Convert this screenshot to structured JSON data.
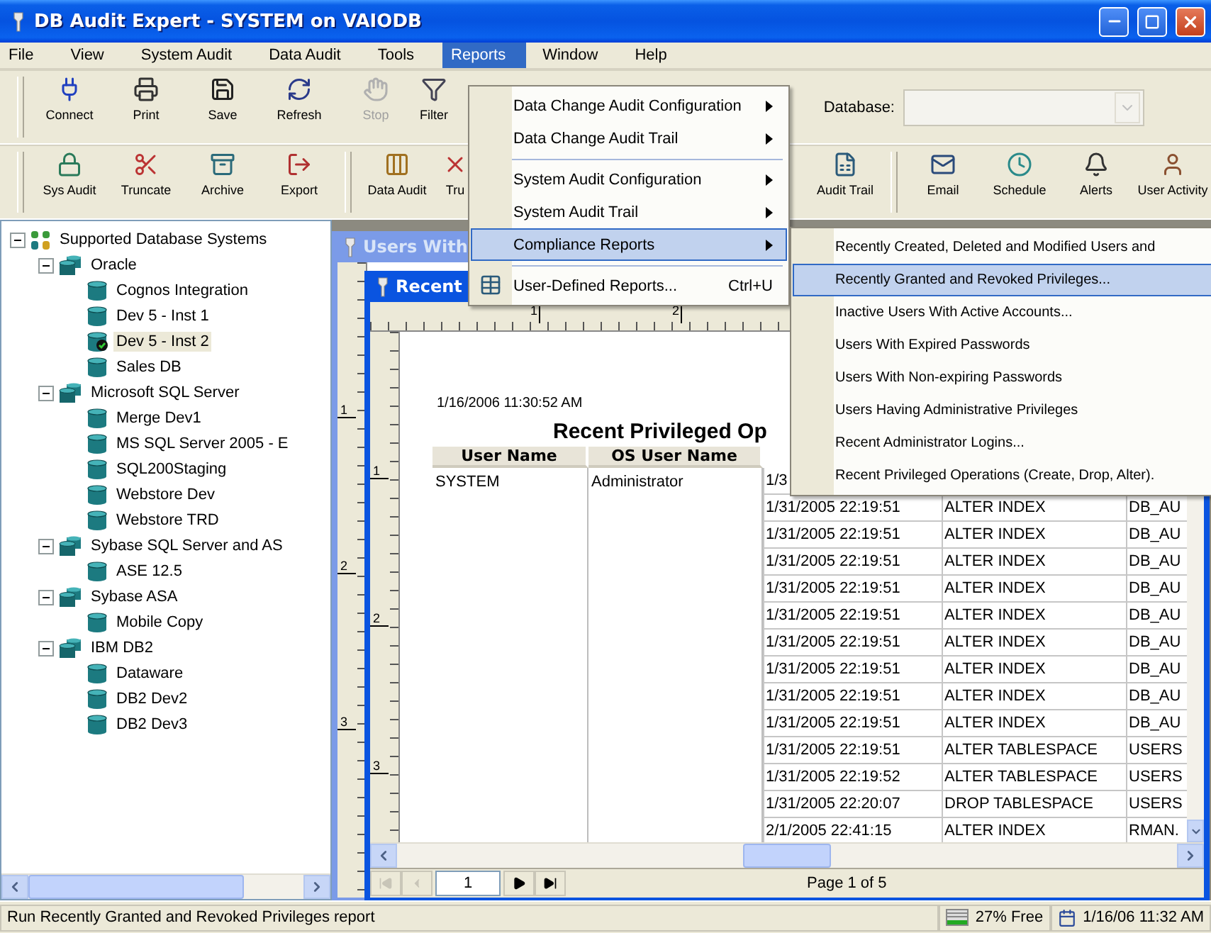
{
  "window": {
    "title": "DB Audit Expert - SYSTEM on VAIODB"
  },
  "menu_bar": [
    {
      "label": "File",
      "selected": false
    },
    {
      "label": "View",
      "selected": false
    },
    {
      "label": "System Audit",
      "selected": false
    },
    {
      "label": "Data Audit",
      "selected": false
    },
    {
      "label": "Tools",
      "selected": false
    },
    {
      "label": "Reports",
      "selected": true
    },
    {
      "label": "Window",
      "selected": false
    },
    {
      "label": "Help",
      "selected": false
    }
  ],
  "toolbar_1": {
    "buttons": [
      {
        "label": "Connect",
        "disabled": false
      },
      {
        "label": "Print",
        "disabled": false
      },
      {
        "label": "Save",
        "disabled": false
      },
      {
        "label": "Refresh",
        "disabled": false
      },
      {
        "label": "Stop",
        "disabled": true
      },
      {
        "label": "Filter",
        "disabled": false
      }
    ],
    "database": {
      "label": "Database:",
      "disabled": true
    }
  },
  "toolbar_2": {
    "groups": [
      [
        {
          "label": "Sys Audit"
        },
        {
          "label": "Truncate"
        },
        {
          "label": "Archive"
        },
        {
          "label": "Export"
        }
      ],
      [
        {
          "label": "Data Audit"
        },
        {
          "label": "Tru"
        }
      ],
      [
        {
          "label": "Audit Trail"
        }
      ],
      [
        {
          "label": "Email"
        },
        {
          "label": "Schedule"
        },
        {
          "label": "Alerts"
        },
        {
          "label": "User Activity"
        }
      ]
    ]
  },
  "tree": {
    "nodes": [
      {
        "label": "Supported Database Systems",
        "expanded": true,
        "selected": false,
        "children": [
          {
            "label": "Oracle",
            "expanded": true,
            "selected": false,
            "children": [
              {
                "label": "Cognos Integration",
                "selected": false
              },
              {
                "label": "Dev 5 - Inst 1",
                "selected": false
              },
              {
                "label": "Dev 5 - Inst 2",
                "selected": true
              },
              {
                "label": "Sales DB",
                "selected": false
              }
            ]
          },
          {
            "label": "Microsoft SQL Server",
            "expanded": true,
            "selected": false,
            "children": [
              {
                "label": "Merge Dev1",
                "selected": false
              },
              {
                "label": "MS SQL Server 2005 - E",
                "selected": false
              },
              {
                "label": "SQL200Staging",
                "selected": false
              },
              {
                "label": "Webstore Dev",
                "selected": false
              },
              {
                "label": "Webstore TRD",
                "selected": false
              }
            ]
          },
          {
            "label": "Sybase SQL Server and AS",
            "expanded": true,
            "selected": false,
            "children": [
              {
                "label": "ASE 12.5",
                "selected": false
              }
            ]
          },
          {
            "label": "Sybase ASA",
            "expanded": true,
            "selected": false,
            "children": [
              {
                "label": "Mobile Copy",
                "selected": false
              }
            ]
          },
          {
            "label": "IBM DB2",
            "expanded": true,
            "selected": false,
            "children": [
              {
                "label": "Dataware",
                "selected": false
              },
              {
                "label": "DB2 Dev2",
                "selected": false
              },
              {
                "label": "DB2 Dev3",
                "selected": false
              }
            ]
          }
        ]
      }
    ]
  },
  "back_window": {
    "title": "Users With",
    "ruler_marks": [
      "1",
      "2",
      "3"
    ]
  },
  "report_window": {
    "title": "Recent",
    "top_ruler_marks": [
      "1",
      "2"
    ],
    "left_ruler_marks": [
      "1",
      "2",
      "3"
    ],
    "report": {
      "timestamp": "1/16/2006 11:30:52 AM",
      "title": "Recent Privileged Op",
      "columns": [
        "User Name",
        "OS User Name"
      ],
      "user": "SYSTEM",
      "os_user": "Administrator",
      "rows": [
        [
          "1/3"
        ],
        [
          "1/31/2005 22:19:51",
          "ALTER INDEX",
          "DB_AU"
        ],
        [
          "1/31/2005 22:19:51",
          "ALTER INDEX",
          "DB_AU"
        ],
        [
          "1/31/2005 22:19:51",
          "ALTER INDEX",
          "DB_AU"
        ],
        [
          "1/31/2005 22:19:51",
          "ALTER INDEX",
          "DB_AU"
        ],
        [
          "1/31/2005 22:19:51",
          "ALTER INDEX",
          "DB_AU"
        ],
        [
          "1/31/2005 22:19:51",
          "ALTER INDEX",
          "DB_AU"
        ],
        [
          "1/31/2005 22:19:51",
          "ALTER INDEX",
          "DB_AU"
        ],
        [
          "1/31/2005 22:19:51",
          "ALTER INDEX",
          "DB_AU"
        ],
        [
          "1/31/2005 22:19:51",
          "ALTER INDEX",
          "DB_AU"
        ],
        [
          "1/31/2005 22:19:51",
          "ALTER TABLESPACE",
          "USERS"
        ],
        [
          "1/31/2005 22:19:52",
          "ALTER TABLESPACE",
          "USERS"
        ],
        [
          "1/31/2005 22:20:07",
          "DROP TABLESPACE",
          "USERS"
        ],
        [
          "2/1/2005 22:41:15",
          "ALTER INDEX",
          "RMAN."
        ]
      ]
    },
    "navigation": {
      "buttons": [
        {
          "disabled": true
        },
        {
          "disabled": true
        },
        {
          "disabled": false
        },
        {
          "disabled": false
        }
      ],
      "page": "1",
      "status": "Page 1 of 5"
    }
  },
  "reports_menu": {
    "items": [
      {
        "kind": "submenu",
        "label": "Data Change Audit Configuration",
        "selected": false
      },
      {
        "kind": "submenu",
        "label": "Data Change Audit Trail",
        "selected": false
      },
      {
        "kind": "separator"
      },
      {
        "kind": "submenu",
        "label": "System Audit Configuration",
        "selected": false
      },
      {
        "kind": "submenu",
        "label": "System Audit Trail",
        "selected": false
      },
      {
        "kind": "submenu",
        "label": "Compliance Reports",
        "selected": true
      },
      {
        "kind": "separator"
      },
      {
        "kind": "command",
        "label": "User-Defined Reports...",
        "shortcut": "Ctrl+U",
        "selected": false
      }
    ]
  },
  "compliance_submenu": {
    "items": [
      {
        "label": "Recently Created, Deleted and Modified Users and",
        "selected": false
      },
      {
        "label": "Recently Granted and Revoked Privileges...",
        "selected": true
      },
      {
        "label": "Inactive Users With Active Accounts...",
        "selected": false
      },
      {
        "label": "Users With Expired Passwords",
        "selected": false
      },
      {
        "label": "Users With Non-expiring Passwords",
        "selected": false
      },
      {
        "label": "Users Having Administrative Privileges",
        "selected": false
      },
      {
        "label": "Recent Administrator Logins...",
        "selected": false
      },
      {
        "label": "Recent Privileged Operations (Create, Drop, Alter).",
        "selected": false
      }
    ]
  },
  "status_bar": {
    "message": "Run Recently Granted and Revoked Privileges report",
    "memory": "27% Free",
    "datetime": "1/16/06 11:32 AM"
  }
}
